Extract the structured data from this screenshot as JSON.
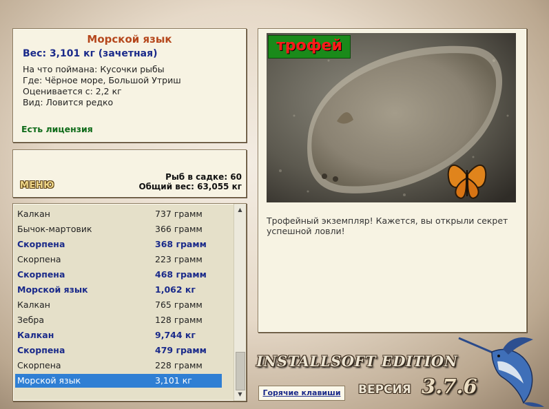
{
  "info": {
    "title": "Морской язык",
    "weight": "Вес: 3,101 кг (зачетная)",
    "caught_on": "На что поймана: Кусочки рыбы",
    "where": "Где: Чёрное море, Большой Утриш",
    "rated_from": "Оценивается с: 2,2 кг",
    "kind": "Вид: Ловится редко",
    "license": "Есть лицензия"
  },
  "cage": {
    "menu_label": "МЕНЮ",
    "fish_count": "Рыб в садке: 60",
    "total_weight": "Общий вес: 63,055 кг"
  },
  "catch_list": [
    {
      "name": "Калкан",
      "weight": "737 грамм",
      "bold": false
    },
    {
      "name": "Бычок-мартовик",
      "weight": "366 грамм",
      "bold": false
    },
    {
      "name": "Скорпена",
      "weight": "368 грамм",
      "bold": true
    },
    {
      "name": "Скорпена",
      "weight": "223 грамм",
      "bold": false
    },
    {
      "name": "Скорпена",
      "weight": "468 грамм",
      "bold": true
    },
    {
      "name": "Морской язык",
      "weight": "1,062 кг",
      "bold": true
    },
    {
      "name": "Калкан",
      "weight": "765 грамм",
      "bold": false
    },
    {
      "name": "Зебра",
      "weight": "128 грамм",
      "bold": false
    },
    {
      "name": "Калкан",
      "weight": "9,744 кг",
      "bold": true
    },
    {
      "name": "Скорпена",
      "weight": "479 грамм",
      "bold": true
    },
    {
      "name": "Скорпена",
      "weight": "228 грамм",
      "bold": false
    },
    {
      "name": "Морской язык",
      "weight": "3,101 кг",
      "bold": false,
      "selected": true
    }
  ],
  "trophy": {
    "badge": "трофей",
    "description": "Трофейный экземпляр! Кажется, вы открыли секрет успешной ловли!"
  },
  "footer": {
    "brand": "INSTALLSOFT EDITION",
    "version_label": "ВЕРСИЯ",
    "version_number": "3.7.6",
    "hotkeys": "Горячие клавиши"
  },
  "colors": {
    "title": "#b5471c",
    "accent_blue": "#1a2a8a",
    "license_green": "#0f6b1a",
    "selection": "#2f7fd4"
  }
}
